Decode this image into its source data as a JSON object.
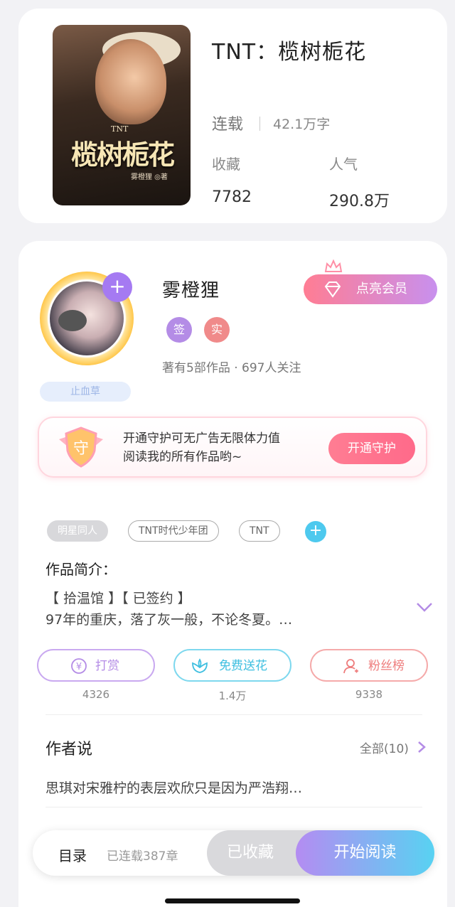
{
  "book": {
    "title": "TNT：榄树栀花",
    "status": "连载",
    "word_count": "42.1万字",
    "collect_label": "收藏",
    "collect_value": "7782",
    "popularity_label": "人气",
    "popularity_value": "290.8万",
    "cover": {
      "tnt_mark": "TNT",
      "title_text": "榄树栀花",
      "author_text": "雾橙狸 ◎著"
    }
  },
  "author": {
    "name": "雾橙狸",
    "badge_signed": "签",
    "badge_real": "实",
    "meta": "著有5部作品 · 697人关注",
    "plant_tag": "止血草",
    "vip_button": "点亮会员"
  },
  "guard": {
    "shield_text": "守",
    "line1": "开通守护可无广告无限体力值",
    "line2": "阅读我的所有作品哟~",
    "button": "开通守护"
  },
  "tags": [
    "明星同人",
    "TNT时代少年团",
    "TNT"
  ],
  "intro": {
    "title": "作品简介：",
    "line1": "【 拾温馆 】【 已签约 】",
    "line2": "97年的重庆，落了灰一般，不论冬夏。…"
  },
  "actions": [
    {
      "label": "打赏",
      "count": "4326",
      "icon": "yen-icon",
      "color": "#b48ce6"
    },
    {
      "label": "免费送花",
      "count": "1.4万",
      "icon": "flower-icon",
      "color": "#4ec9e6"
    },
    {
      "label": "粉丝榜",
      "count": "9338",
      "icon": "fans-icon",
      "color": "#f08a8a"
    }
  ],
  "author_says": {
    "title": "作者说",
    "all_label": "全部(10)",
    "text": "思琪对宋雅柠的表层欢欣只是因为严浩翔…"
  },
  "bottom_bar": {
    "toc": "目录",
    "chapters": "已连载387章",
    "collected": "已收藏",
    "read": "开始阅读"
  },
  "colors": {
    "accent_purple": "#a57af2",
    "accent_pink": "#ff7d93",
    "accent_cyan": "#4ec9ee"
  }
}
